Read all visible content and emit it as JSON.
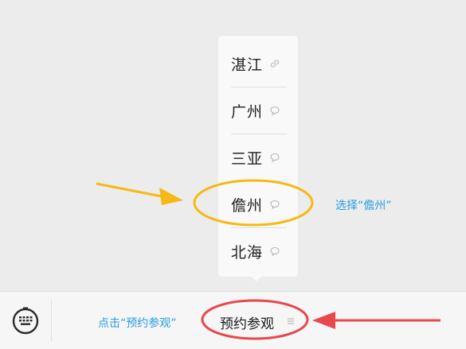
{
  "menu": {
    "items": [
      {
        "label": "湛江",
        "icon": "link-icon"
      },
      {
        "label": "广州",
        "icon": "chat-bubble-icon"
      },
      {
        "label": "三亚",
        "icon": "chat-bubble-icon"
      },
      {
        "label": "儋州",
        "icon": "chat-bubble-icon"
      },
      {
        "label": "北海",
        "icon": "chat-bubble-icon"
      }
    ]
  },
  "bottom_bar": {
    "keyboard_icon": "keyboard-icon",
    "menu_label": "预约参观",
    "menu_icon": "list-icon"
  },
  "annotations": {
    "select_note": "选择“儋州”",
    "click_note": "点击“预约参观”",
    "colors": {
      "yellow": "#f5b914",
      "red": "#e8474c",
      "note_text": "#2a9ce0"
    }
  }
}
